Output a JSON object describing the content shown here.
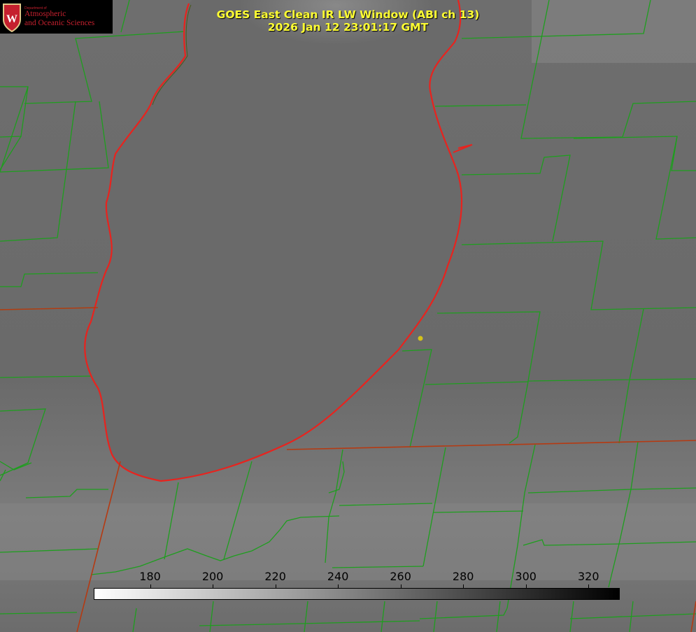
{
  "logo": {
    "department": "Department of",
    "line1": "Atmospheric",
    "line2": "and Oceanic Sciences"
  },
  "title": {
    "line1": "GOES East Clean IR LW Window (ABI ch 13)",
    "line2": "2026 Jan 12 23:01:17 GMT"
  },
  "colorbar": {
    "min": 162,
    "max": 330,
    "gradient": [
      "#ffffff",
      "#000000"
    ],
    "ticks": [
      "180",
      "200",
      "220",
      "240",
      "260",
      "280",
      "300",
      "320"
    ]
  },
  "colors": {
    "coastline": "#e8231e",
    "county_lines": "#1e9e1e",
    "state_line": "#b53a12",
    "title_text": "#ffff33",
    "marker": "#d4c21a"
  }
}
